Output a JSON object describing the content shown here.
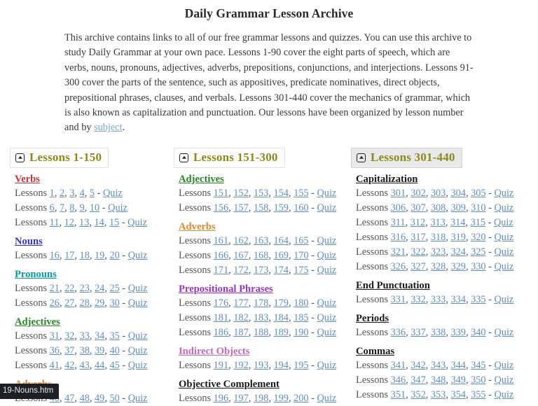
{
  "page": {
    "title": "Daily Grammar Lesson Archive",
    "intro_part1": "This archive contains links to all of our free grammar lessons and quizzes.  You can use this archive to study Daily Grammar at your own pace.  Lessons 1-90 cover the eight parts of speech, which are verbs, nouns, pronouns, adjectives, adverbs, prepositions, conjunctions, and interjections.  Lessons 91-300 cover the parts of the sentence, such as appositives, predicate nominatives, direct objects, prepositional phrases, clauses, and verbals.  Lessons 301-440 cover the mechanics of grammar, which is also known as capitalization and punctuation.  Our lessons have been organized by lesson number and by ",
    "intro_link": "subject",
    "intro_part2": ".",
    "lessons_word": "Lessons",
    "quiz_word": "Quiz",
    "dash": "-",
    "comma": ", "
  },
  "status_tooltip": {
    "text": "19-Nouns.htm"
  },
  "colors": {
    "header_title": "#8a8a18",
    "link": "#5d8ec9",
    "intro_link": "#7ba7d7",
    "body_text": "#555555",
    "verbs": "#cc3333",
    "nouns": "#3333cc",
    "pronouns": "#00a0a0",
    "adjectives": "#228b22",
    "adverbs": "#e08a2e",
    "prepositional_phrases": "#9933cc",
    "indirect_objects": "#cc66bb",
    "black": "#1a1a1a"
  },
  "columns": [
    {
      "header": {
        "icon": "collapse-square-up-icon",
        "label": "Lessons 1-150",
        "hovered": false
      },
      "groups": [
        {
          "heading": "Verbs",
          "color": "#cc3333",
          "rows": [
            {
              "lessons": [
                "1",
                "2",
                "3",
                "4",
                "5"
              ],
              "quiz": "Quiz"
            },
            {
              "lessons": [
                "6",
                "7",
                "8",
                "9",
                "10"
              ],
              "quiz": "Quiz"
            },
            {
              "lessons": [
                "11",
                "12",
                "13",
                "14",
                "15"
              ],
              "quiz": "Quiz"
            }
          ]
        },
        {
          "heading": "Nouns",
          "color": "#3333cc",
          "rows": [
            {
              "lessons": [
                "16",
                "17",
                "18",
                "19",
                "20"
              ],
              "quiz": "Quiz"
            }
          ]
        },
        {
          "heading": "Pronouns",
          "color": "#00a0a0",
          "rows": [
            {
              "lessons": [
                "21",
                "22",
                "23",
                "24",
                "25"
              ],
              "quiz": "Quiz"
            },
            {
              "lessons": [
                "26",
                "27",
                "28",
                "29",
                "30"
              ],
              "quiz": "Quiz"
            }
          ]
        },
        {
          "heading": "Adjectives",
          "color": "#228b22",
          "rows": [
            {
              "lessons": [
                "31",
                "32",
                "33",
                "34",
                "35"
              ],
              "quiz": "Quiz"
            },
            {
              "lessons": [
                "36",
                "37",
                "38",
                "39",
                "40"
              ],
              "quiz": "Quiz"
            },
            {
              "lessons": [
                "41",
                "42",
                "43",
                "44",
                "45"
              ],
              "quiz": "Quiz"
            }
          ]
        },
        {
          "heading": "Adverbs",
          "color": "#e08a2e",
          "rows": [
            {
              "lessons": [
                "46",
                "47",
                "48",
                "49",
                "50"
              ],
              "quiz": "Quiz"
            }
          ]
        }
      ]
    },
    {
      "header": {
        "icon": "collapse-square-up-icon",
        "label": "Lessons 151-300",
        "hovered": false
      },
      "groups": [
        {
          "heading": "Adjectives",
          "color": "#228b22",
          "rows": [
            {
              "lessons": [
                "151",
                "152",
                "153",
                "154",
                "155"
              ],
              "quiz": "Quiz"
            },
            {
              "lessons": [
                "156",
                "157",
                "158",
                "159",
                "160"
              ],
              "quiz": "Quiz"
            }
          ]
        },
        {
          "heading": "Adverbs",
          "color": "#e08a2e",
          "rows": [
            {
              "lessons": [
                "161",
                "162",
                "163",
                "164",
                "165"
              ],
              "quiz": "Quiz"
            },
            {
              "lessons": [
                "166",
                "167",
                "168",
                "169",
                "170"
              ],
              "quiz": "Quiz"
            },
            {
              "lessons": [
                "171",
                "172",
                "173",
                "174",
                "175"
              ],
              "quiz": "Quiz"
            }
          ]
        },
        {
          "heading": "Prepositional Phrases",
          "color": "#9933cc",
          "rows": [
            {
              "lessons": [
                "176",
                "177",
                "178",
                "179",
                "180"
              ],
              "quiz": "Quiz"
            },
            {
              "lessons": [
                "181",
                "182",
                "183",
                "184",
                "185"
              ],
              "quiz": "Quiz"
            },
            {
              "lessons": [
                "186",
                "187",
                "188",
                "189",
                "190"
              ],
              "quiz": "Quiz"
            }
          ]
        },
        {
          "heading": "Indirect Objects",
          "color": "#cc66bb",
          "rows": [
            {
              "lessons": [
                "191",
                "192",
                "193",
                "194",
                "195"
              ],
              "quiz": "Quiz"
            }
          ]
        },
        {
          "heading": "Objective Complement",
          "color": "#1a1a1a",
          "rows": [
            {
              "lessons": [
                "196",
                "197",
                "198",
                "199",
                "200"
              ],
              "quiz": "Quiz"
            }
          ]
        }
      ]
    },
    {
      "header": {
        "icon": "collapse-square-up-icon",
        "label": "Lessons 301-440",
        "hovered": true
      },
      "groups": [
        {
          "heading": "Capitalization",
          "color": "#1a1a1a",
          "rows": [
            {
              "lessons": [
                "301",
                "302",
                "303",
                "304",
                "305"
              ],
              "quiz": "Quiz"
            },
            {
              "lessons": [
                "306",
                "307",
                "308",
                "309",
                "310"
              ],
              "quiz": "Quiz"
            },
            {
              "lessons": [
                "311",
                "312",
                "313",
                "314",
                "315"
              ],
              "quiz": "Quiz"
            },
            {
              "lessons": [
                "316",
                "317",
                "318",
                "319",
                "320"
              ],
              "quiz": "Quiz"
            },
            {
              "lessons": [
                "321",
                "322",
                "323",
                "324",
                "325"
              ],
              "quiz": "Quiz"
            },
            {
              "lessons": [
                "326",
                "327",
                "328",
                "329",
                "330"
              ],
              "quiz": "Quiz"
            }
          ]
        },
        {
          "heading": "End Punctuation",
          "color": "#1a1a1a",
          "rows": [
            {
              "lessons": [
                "331",
                "332",
                "333",
                "334",
                "335"
              ],
              "quiz": "Quiz"
            }
          ]
        },
        {
          "heading": "Periods",
          "color": "#1a1a1a",
          "rows": [
            {
              "lessons": [
                "336",
                "337",
                "338",
                "339",
                "340"
              ],
              "quiz": "Quiz"
            }
          ]
        },
        {
          "heading": "Commas",
          "color": "#1a1a1a",
          "rows": [
            {
              "lessons": [
                "341",
                "342",
                "343",
                "344",
                "345"
              ],
              "quiz": "Quiz"
            },
            {
              "lessons": [
                "346",
                "347",
                "348",
                "349",
                "350"
              ],
              "quiz": "Quiz"
            },
            {
              "lessons": [
                "351",
                "352",
                "353",
                "354",
                "355"
              ],
              "quiz": "Quiz"
            }
          ]
        }
      ]
    }
  ]
}
